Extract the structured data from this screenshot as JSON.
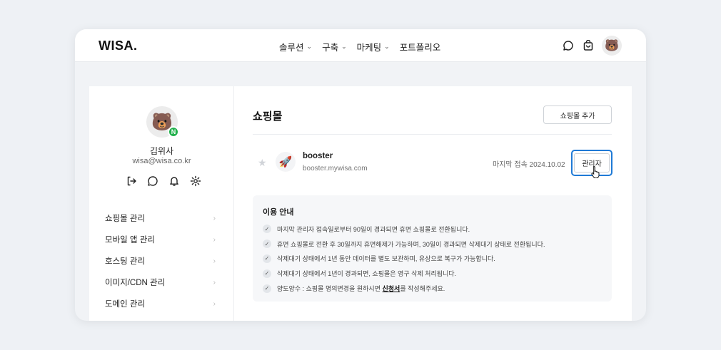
{
  "header": {
    "logo": "WISA.",
    "nav": [
      {
        "label": "솔루션",
        "has_dropdown": true
      },
      {
        "label": "구축",
        "has_dropdown": true
      },
      {
        "label": "마케팅",
        "has_dropdown": true
      },
      {
        "label": "포트폴리오",
        "has_dropdown": false
      }
    ],
    "icons": [
      "chat-icon",
      "cart-icon",
      "bear-avatar"
    ]
  },
  "profile": {
    "name": "김위사",
    "email": "wisa@wisa.co.kr",
    "badge": "N",
    "actions": [
      "logout-icon",
      "chat-icon",
      "bell-icon",
      "gear-icon"
    ]
  },
  "sidebar": {
    "items": [
      {
        "label": "쇼핑몰 관리"
      },
      {
        "label": "모바일 앱 관리"
      },
      {
        "label": "호스팅 관리"
      },
      {
        "label": "이미지/CDN 관리"
      },
      {
        "label": "도메인 관리"
      }
    ]
  },
  "main": {
    "title": "쇼핑몰",
    "add_button": "쇼핑몰 추가",
    "shop": {
      "name": "booster",
      "url": "booster.mywisa.com",
      "last_access": "마지막 접속 2024.10.02",
      "admin_button": "관리자"
    },
    "notice": {
      "title": "이용 안내",
      "items": [
        "마지막 관리자 접속일로부터 90일이 경과되면 휴면 쇼핑몰로 전환됩니다.",
        "휴면 쇼핑몰로 전환 후 30일까지 휴면해제가 가능하며, 30일이 경과되면 삭제대기 상태로 전환됩니다.",
        "삭제대기 상태에서 1년 동안 데이터를 별도 보관하며, 유상으로 복구가 가능합니다.",
        "삭제대기 상태에서 1년이 경과되면, 쇼핑몰은 영구 삭제 처리됩니다."
      ],
      "last_item_prefix": "양도양수 : 쇼핑몰 명의변경을 원하시면 ",
      "last_item_link": "신청서",
      "last_item_suffix": "를 작성해주세요."
    }
  },
  "colors": {
    "accent_focus": "#1f7ad6",
    "badge_green": "#22b14c",
    "background": "#eef1f5"
  }
}
